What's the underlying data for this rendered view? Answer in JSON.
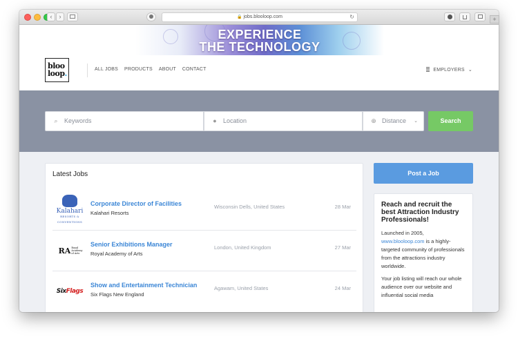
{
  "browser": {
    "url": "jobs.blooloop.com",
    "lock_glyph": "🔒",
    "reload_glyph": "↻",
    "back_glyph": "‹",
    "forward_glyph": "›",
    "new_tab_glyph": "+"
  },
  "banner": {
    "line1": "EXPERIENCE",
    "line2": "THE TECHNOLOGY"
  },
  "site": {
    "logo_line1": "bloo",
    "logo_line2": "loop",
    "logo_dot": ".",
    "nav": [
      "ALL JOBS",
      "PRODUCTS",
      "ABOUT",
      "CONTACT"
    ],
    "employers_label": "EMPLOYERS",
    "employers_caret": "⌄"
  },
  "search": {
    "keywords_placeholder": "Keywords",
    "location_placeholder": "Location",
    "distance_placeholder": "Distance",
    "distance_caret": "⌄",
    "button_label": "Search"
  },
  "jobs": {
    "heading": "Latest Jobs",
    "items": [
      {
        "title": "Corporate Director of Facilities",
        "company": "Kalahari Resorts",
        "location": "Wisconsin Dells, United States",
        "date": "28 Mar",
        "logo_text": "Kalahari",
        "logo_sub": "RESORTS & CONVENTIONS"
      },
      {
        "title": "Senior Exhibitions Manager",
        "company": "Royal Academy of Arts",
        "location": "London, United Kingdom",
        "date": "27 Mar",
        "logo_text": "RA",
        "logo_sub": "Royal Academy of Arts"
      },
      {
        "title": "Show and Entertainment Technician",
        "company": "Six Flags New England",
        "location": "Agawam, United States",
        "date": "24 Mar",
        "logo_text": "Six",
        "logo_text2": "Flags"
      }
    ]
  },
  "sidebar": {
    "post_button": "Post a Job",
    "promo_title": "Reach and recruit the best Attraction Industry Professionals!",
    "promo_p1_before": "Launched in 2005,",
    "promo_p1_link": "www.blooloop.com",
    "promo_p1_after": "is a highly-targeted community of professionals from the attractions industry worldwide.",
    "promo_p2": "Your job listing will reach our whole audience over our website and influential social media"
  },
  "colors": {
    "search_band": "#8a92a3",
    "search_button": "#76c965",
    "post_button": "#5a9be0",
    "link_blue": "#3b86d6"
  }
}
